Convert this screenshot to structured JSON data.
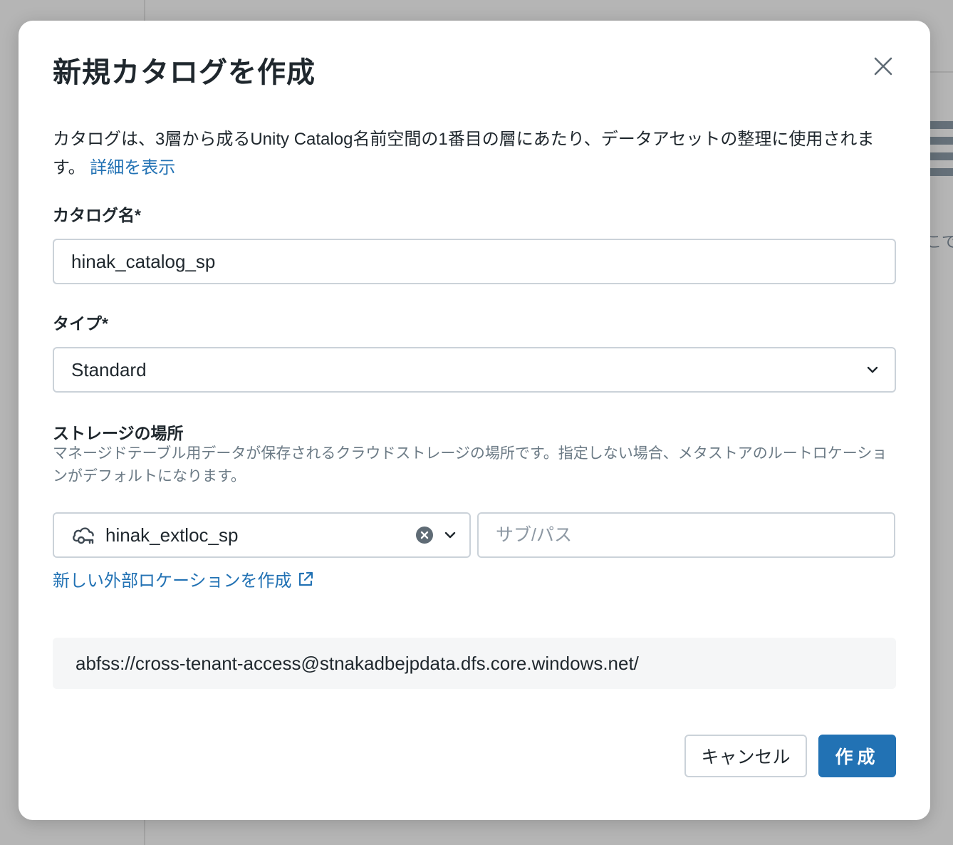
{
  "background": {
    "partial_text": "こで"
  },
  "dialog": {
    "title": "新規カタログを作成",
    "close_icon": "close-icon",
    "description": "カタログは、3層から成るUnity Catalog名前空間の1番目の層にあたり、データアセットの整理に使用されます。",
    "details_link": "詳細を表示",
    "catalog_name": {
      "label": "カタログ名*",
      "value": "hinak_catalog_sp"
    },
    "type": {
      "label": "タイプ*",
      "selected": "Standard"
    },
    "storage": {
      "label": "ストレージの場所",
      "help": "マネージドテーブル用データが保存されるクラウドストレージの場所です。指定しない場合、メタストアのルートロケーションがデフォルトになります。",
      "external_location": "hinak_extloc_sp",
      "subpath_placeholder": "サブ/パス",
      "new_location_link": "新しい外部ロケーションを作成",
      "resolved_path": "abfss://cross-tenant-access@stnakadbejpdata.dfs.core.windows.net/"
    },
    "buttons": {
      "cancel": "キャンセル",
      "create": "作成"
    }
  },
  "colors": {
    "primary": "#2272b4",
    "text": "#1f272d",
    "muted": "#6b7a85",
    "border": "#cbd2d9",
    "overlay": "#b5b5b5"
  }
}
